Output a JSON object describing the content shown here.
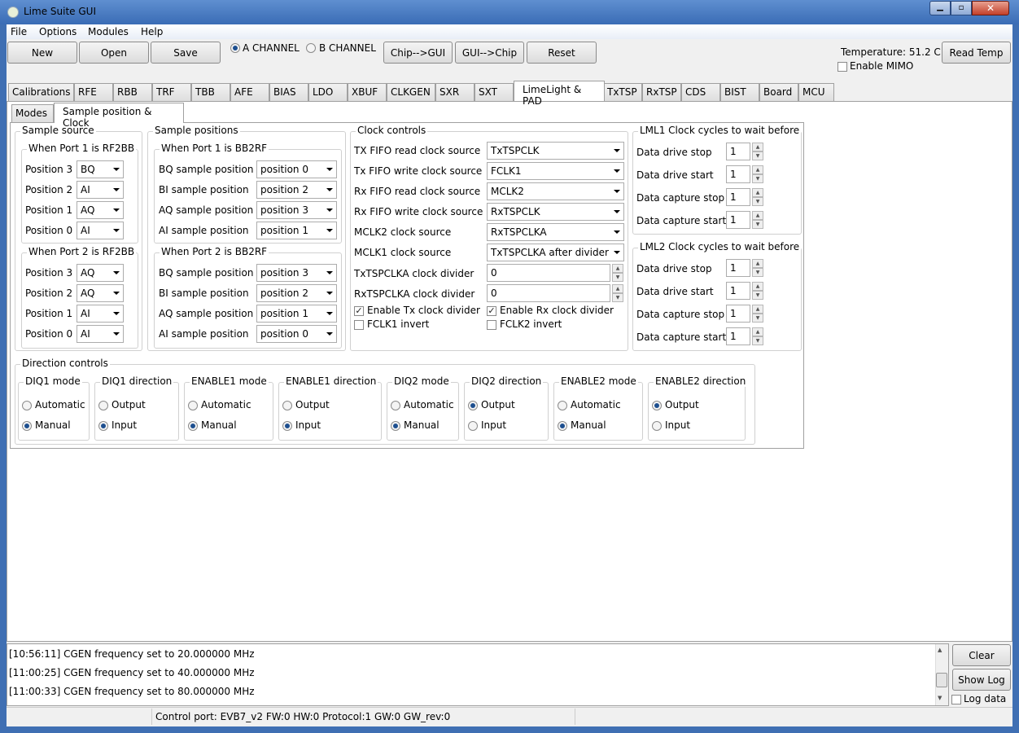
{
  "window": {
    "title": "Lime Suite GUI"
  },
  "menu": [
    "File",
    "Options",
    "Modules",
    "Help"
  ],
  "toolbar": {
    "new": "New",
    "open": "Open",
    "save": "Save",
    "channel_a": "A CHANNEL",
    "channel_b": "B CHANNEL",
    "selected_channel": "A",
    "chip_to_gui": "Chip-->GUI",
    "gui_to_chip": "GUI-->Chip",
    "reset": "Reset",
    "temperature": "Temperature: 51.2 C",
    "read_temp": "Read Temp",
    "enable_mimo": "Enable MIMO",
    "enable_mimo_checked": false
  },
  "tabs": [
    "Calibrations",
    "RFE",
    "RBB",
    "TRF",
    "TBB",
    "AFE",
    "BIAS",
    "LDO",
    "XBUF",
    "CLKGEN",
    "SXR",
    "SXT",
    "LimeLight & PAD",
    "TxTSP",
    "RxTSP",
    "CDS",
    "BIST",
    "Board",
    "MCU"
  ],
  "active_tab": "LimeLight & PAD",
  "subtabs": [
    "Modes",
    "Sample position & Clock"
  ],
  "active_subtab": "Sample position & Clock",
  "sample_source": {
    "title": "Sample source",
    "port1": {
      "title": "When Port 1 is RF2BB",
      "rows": [
        {
          "label": "Position 3",
          "value": "BQ"
        },
        {
          "label": "Position 2",
          "value": "AI"
        },
        {
          "label": "Position 1",
          "value": "AQ"
        },
        {
          "label": "Position 0",
          "value": "AI"
        }
      ]
    },
    "port2": {
      "title": "When Port 2 is RF2BB",
      "rows": [
        {
          "label": "Position 3",
          "value": "AQ"
        },
        {
          "label": "Position 2",
          "value": "AQ"
        },
        {
          "label": "Position 1",
          "value": "AI"
        },
        {
          "label": "Position 0",
          "value": "AI"
        }
      ]
    }
  },
  "sample_positions": {
    "title": "Sample positions",
    "port1": {
      "title": "When Port 1 is BB2RF",
      "rows": [
        {
          "label": "BQ sample position",
          "value": "position 0"
        },
        {
          "label": "BI sample position",
          "value": "position 2"
        },
        {
          "label": "AQ sample position",
          "value": "position 3"
        },
        {
          "label": "AI sample position",
          "value": "position 1"
        }
      ]
    },
    "port2": {
      "title": "When Port 2 is BB2RF",
      "rows": [
        {
          "label": "BQ sample position",
          "value": "position 3"
        },
        {
          "label": "BI sample position",
          "value": "position 2"
        },
        {
          "label": "AQ sample position",
          "value": "position 1"
        },
        {
          "label": "AI sample position",
          "value": "position 0"
        }
      ]
    }
  },
  "clock_controls": {
    "title": "Clock controls",
    "combos": [
      {
        "label": "TX FIFO read clock source",
        "value": "TxTSPCLK"
      },
      {
        "label": "Tx FIFO write clock source",
        "value": "FCLK1"
      },
      {
        "label": "Rx FIFO read clock source",
        "value": "MCLK2"
      },
      {
        "label": "Rx FIFO write clock source",
        "value": "RxTSPCLK"
      },
      {
        "label": "MCLK2 clock source",
        "value": "RxTSPCLKA"
      },
      {
        "label": "MCLK1 clock source",
        "value": "TxTSPCLKA after divider"
      }
    ],
    "spins": [
      {
        "label": "TxTSPCLKA clock divider",
        "value": "0"
      },
      {
        "label": "RxTSPCLKA clock divider",
        "value": "0"
      }
    ],
    "checks": [
      {
        "label": "Enable Tx clock divider",
        "checked": true
      },
      {
        "label": "Enable Rx clock divider",
        "checked": true
      },
      {
        "label": "FCLK1 invert",
        "checked": false
      },
      {
        "label": "FCLK2 invert",
        "checked": false
      }
    ]
  },
  "lml1": {
    "title": "LML1 Clock cycles to wait before",
    "rows": [
      {
        "label": "Data drive stop",
        "value": "1"
      },
      {
        "label": "Data drive start",
        "value": "1"
      },
      {
        "label": "Data capture stop",
        "value": "1"
      },
      {
        "label": "Data capture start",
        "value": "1"
      }
    ]
  },
  "lml2": {
    "title": "LML2 Clock cycles to wait before",
    "rows": [
      {
        "label": "Data drive stop",
        "value": "1"
      },
      {
        "label": "Data drive start",
        "value": "1"
      },
      {
        "label": "Data capture stop",
        "value": "1"
      },
      {
        "label": "Data capture start",
        "value": "1"
      }
    ]
  },
  "direction": {
    "title": "Direction controls",
    "groups": [
      {
        "title": "DIQ1 mode",
        "options": [
          "Automatic",
          "Manual"
        ],
        "selected": 1
      },
      {
        "title": "DIQ1 direction",
        "options": [
          "Output",
          "Input"
        ],
        "selected": 1
      },
      {
        "title": "ENABLE1 mode",
        "options": [
          "Automatic",
          "Manual"
        ],
        "selected": 1
      },
      {
        "title": "ENABLE1 direction",
        "options": [
          "Output",
          "Input"
        ],
        "selected": 1
      },
      {
        "title": "DIQ2 mode",
        "options": [
          "Automatic",
          "Manual"
        ],
        "selected": 1
      },
      {
        "title": "DIQ2 direction",
        "options": [
          "Output",
          "Input"
        ],
        "selected": 0
      },
      {
        "title": "ENABLE2 mode",
        "options": [
          "Automatic",
          "Manual"
        ],
        "selected": 1
      },
      {
        "title": "ENABLE2 direction",
        "options": [
          "Output",
          "Input"
        ],
        "selected": 0
      }
    ]
  },
  "log": {
    "lines": [
      "[10:56:11] CGEN frequency set to 20.000000 MHz",
      "[11:00:25] CGEN frequency set to 40.000000 MHz",
      "[11:00:33] CGEN frequency set to 80.000000 MHz"
    ],
    "clear": "Clear",
    "show_log": "Show Log",
    "log_data": "Log data",
    "log_data_checked": false
  },
  "status": {
    "control_port": "Control port: EVB7_v2 FW:0 HW:0 Protocol:1 GW:0 GW_rev:0"
  }
}
